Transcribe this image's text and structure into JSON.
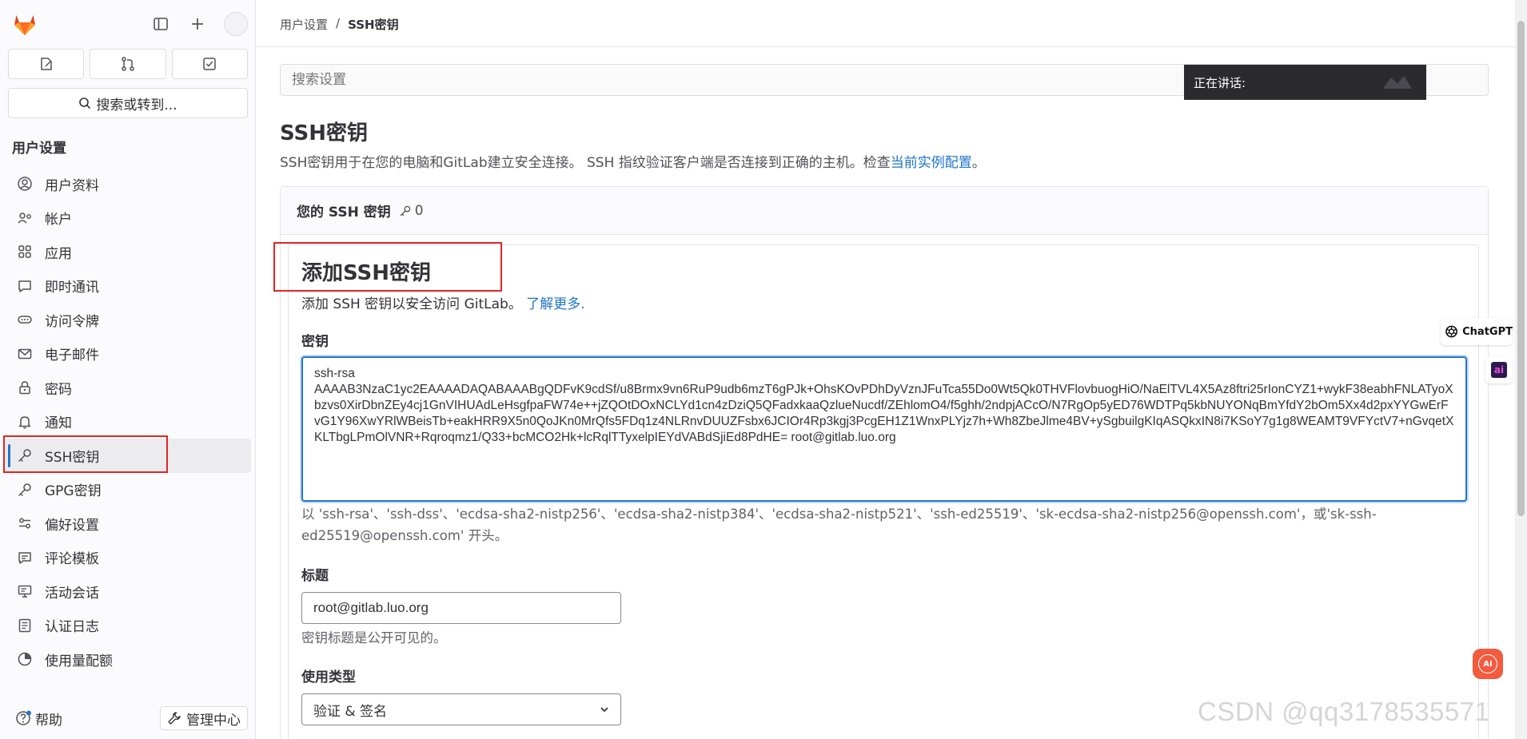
{
  "sidebar": {
    "search_label": "搜索或转到...",
    "heading": "用户设置",
    "items": [
      {
        "label": "用户资料",
        "icon": "user-icon"
      },
      {
        "label": "帐户",
        "icon": "account-icon"
      },
      {
        "label": "应用",
        "icon": "applications-icon"
      },
      {
        "label": "即时通讯",
        "icon": "chat-icon"
      },
      {
        "label": "访问令牌",
        "icon": "token-icon"
      },
      {
        "label": "电子邮件",
        "icon": "mail-icon"
      },
      {
        "label": "密码",
        "icon": "lock-icon"
      },
      {
        "label": "通知",
        "icon": "bell-icon"
      },
      {
        "label": "SSH密钥",
        "icon": "key-icon",
        "active": true
      },
      {
        "label": "GPG密钥",
        "icon": "key-icon"
      },
      {
        "label": "偏好设置",
        "icon": "preferences-icon"
      },
      {
        "label": "评论模板",
        "icon": "comment-template-icon"
      },
      {
        "label": "活动会话",
        "icon": "monitor-icon"
      },
      {
        "label": "认证日志",
        "icon": "log-icon"
      },
      {
        "label": "使用量配额",
        "icon": "quota-icon"
      }
    ],
    "help_label": "帮助",
    "admin_label": "管理中心"
  },
  "breadcrumb": {
    "parent": "用户设置",
    "separator": "/",
    "current": "SSH密钥"
  },
  "settings_search": {
    "placeholder": "搜索设置"
  },
  "overlay": {
    "label": "正在讲话:"
  },
  "page": {
    "title": "SSH密钥",
    "description": "SSH密钥用于在您的电脑和GitLab建立安全连接。 SSH 指纹验证客户端是否连接到正确的主机。检查",
    "description_link": "当前实例配置",
    "description_end": "。"
  },
  "keys_card": {
    "header": "您的 SSH 密钥",
    "count": "0"
  },
  "add_form": {
    "title": "添加SSH密钥",
    "description": "添加 SSH 密钥以安全访问 GitLab。",
    "learn_more": "了解更多.",
    "key_label": "密钥",
    "key_value": "ssh-rsa\nAAAAB3NzaC1yc2EAAAADAQABAAABgQDFvK9cdSf/u8Brmx9vn6RuP9udb6mzT6gPJk+OhsKOvPDhDyVznJFuTca55Do0Wt5Qk0THVFlovbuogHiO/NaElTVL4X5Az8ftri25rIonCYZ1+wykF38eabhFNLATyoXbzvs0XirDbnZEy4cj1GnVIHUAdLeHsgfpaFW74e++jZQOtDOxNCLYd1cn4zDziQ5QFadxkaaQzlueNucdf/ZEhlomO4/f5ghh/2ndpjACcO/N7RgOp5yED76WDTPq5kbNUYONqBmYfdY2bOm5Xx4d2pxYYGwErFvG1Y96XwYRlWBeisTb+eakHRR9X5n0QoJKn0MrQfs5FDq1z4NLRnvDUUZFsbx6JCIOr4Rp3kgj3PcgEH1Z1WnxPLYjz7h+Wh8ZbeJlme4BV+ySgbuilgKIqASQkxIN8i7KSoY7g1g8WEAMT9VFYctV7+nGvqetXKLTbgLPmOlVNR+Rqroqmz1/Q33+bcMCO2Hk+lcRqlTTyxelpIEYdVABdSjiEd8PdHE= root@gitlab.luo.org",
    "key_hint": "以 'ssh-rsa'、'ssh-dss'、'ecdsa-sha2-nistp256'、'ecdsa-sha2-nistp384'、'ecdsa-sha2-nistp521'、'ssh-ed25519'、'sk-ecdsa-sha2-nistp256@openssh.com'，或'sk-ssh-ed25519@openssh.com' 开头。",
    "title_label": "标题",
    "title_value": "root@gitlab.luo.org",
    "title_hint": "密钥标题是公开可见的。",
    "usage_label": "使用类型",
    "usage_value": "验证 & 签名"
  },
  "widgets": {
    "chatgpt_label": "ChatGPT",
    "ai_side_label": "ai",
    "ai_float_label": "AI"
  },
  "watermark": "CSDN @qq3178535571",
  "colors": {
    "accent": "#1f75cb",
    "highlight_box": "#e02424",
    "gitlab_orange": "#fc6d26"
  }
}
